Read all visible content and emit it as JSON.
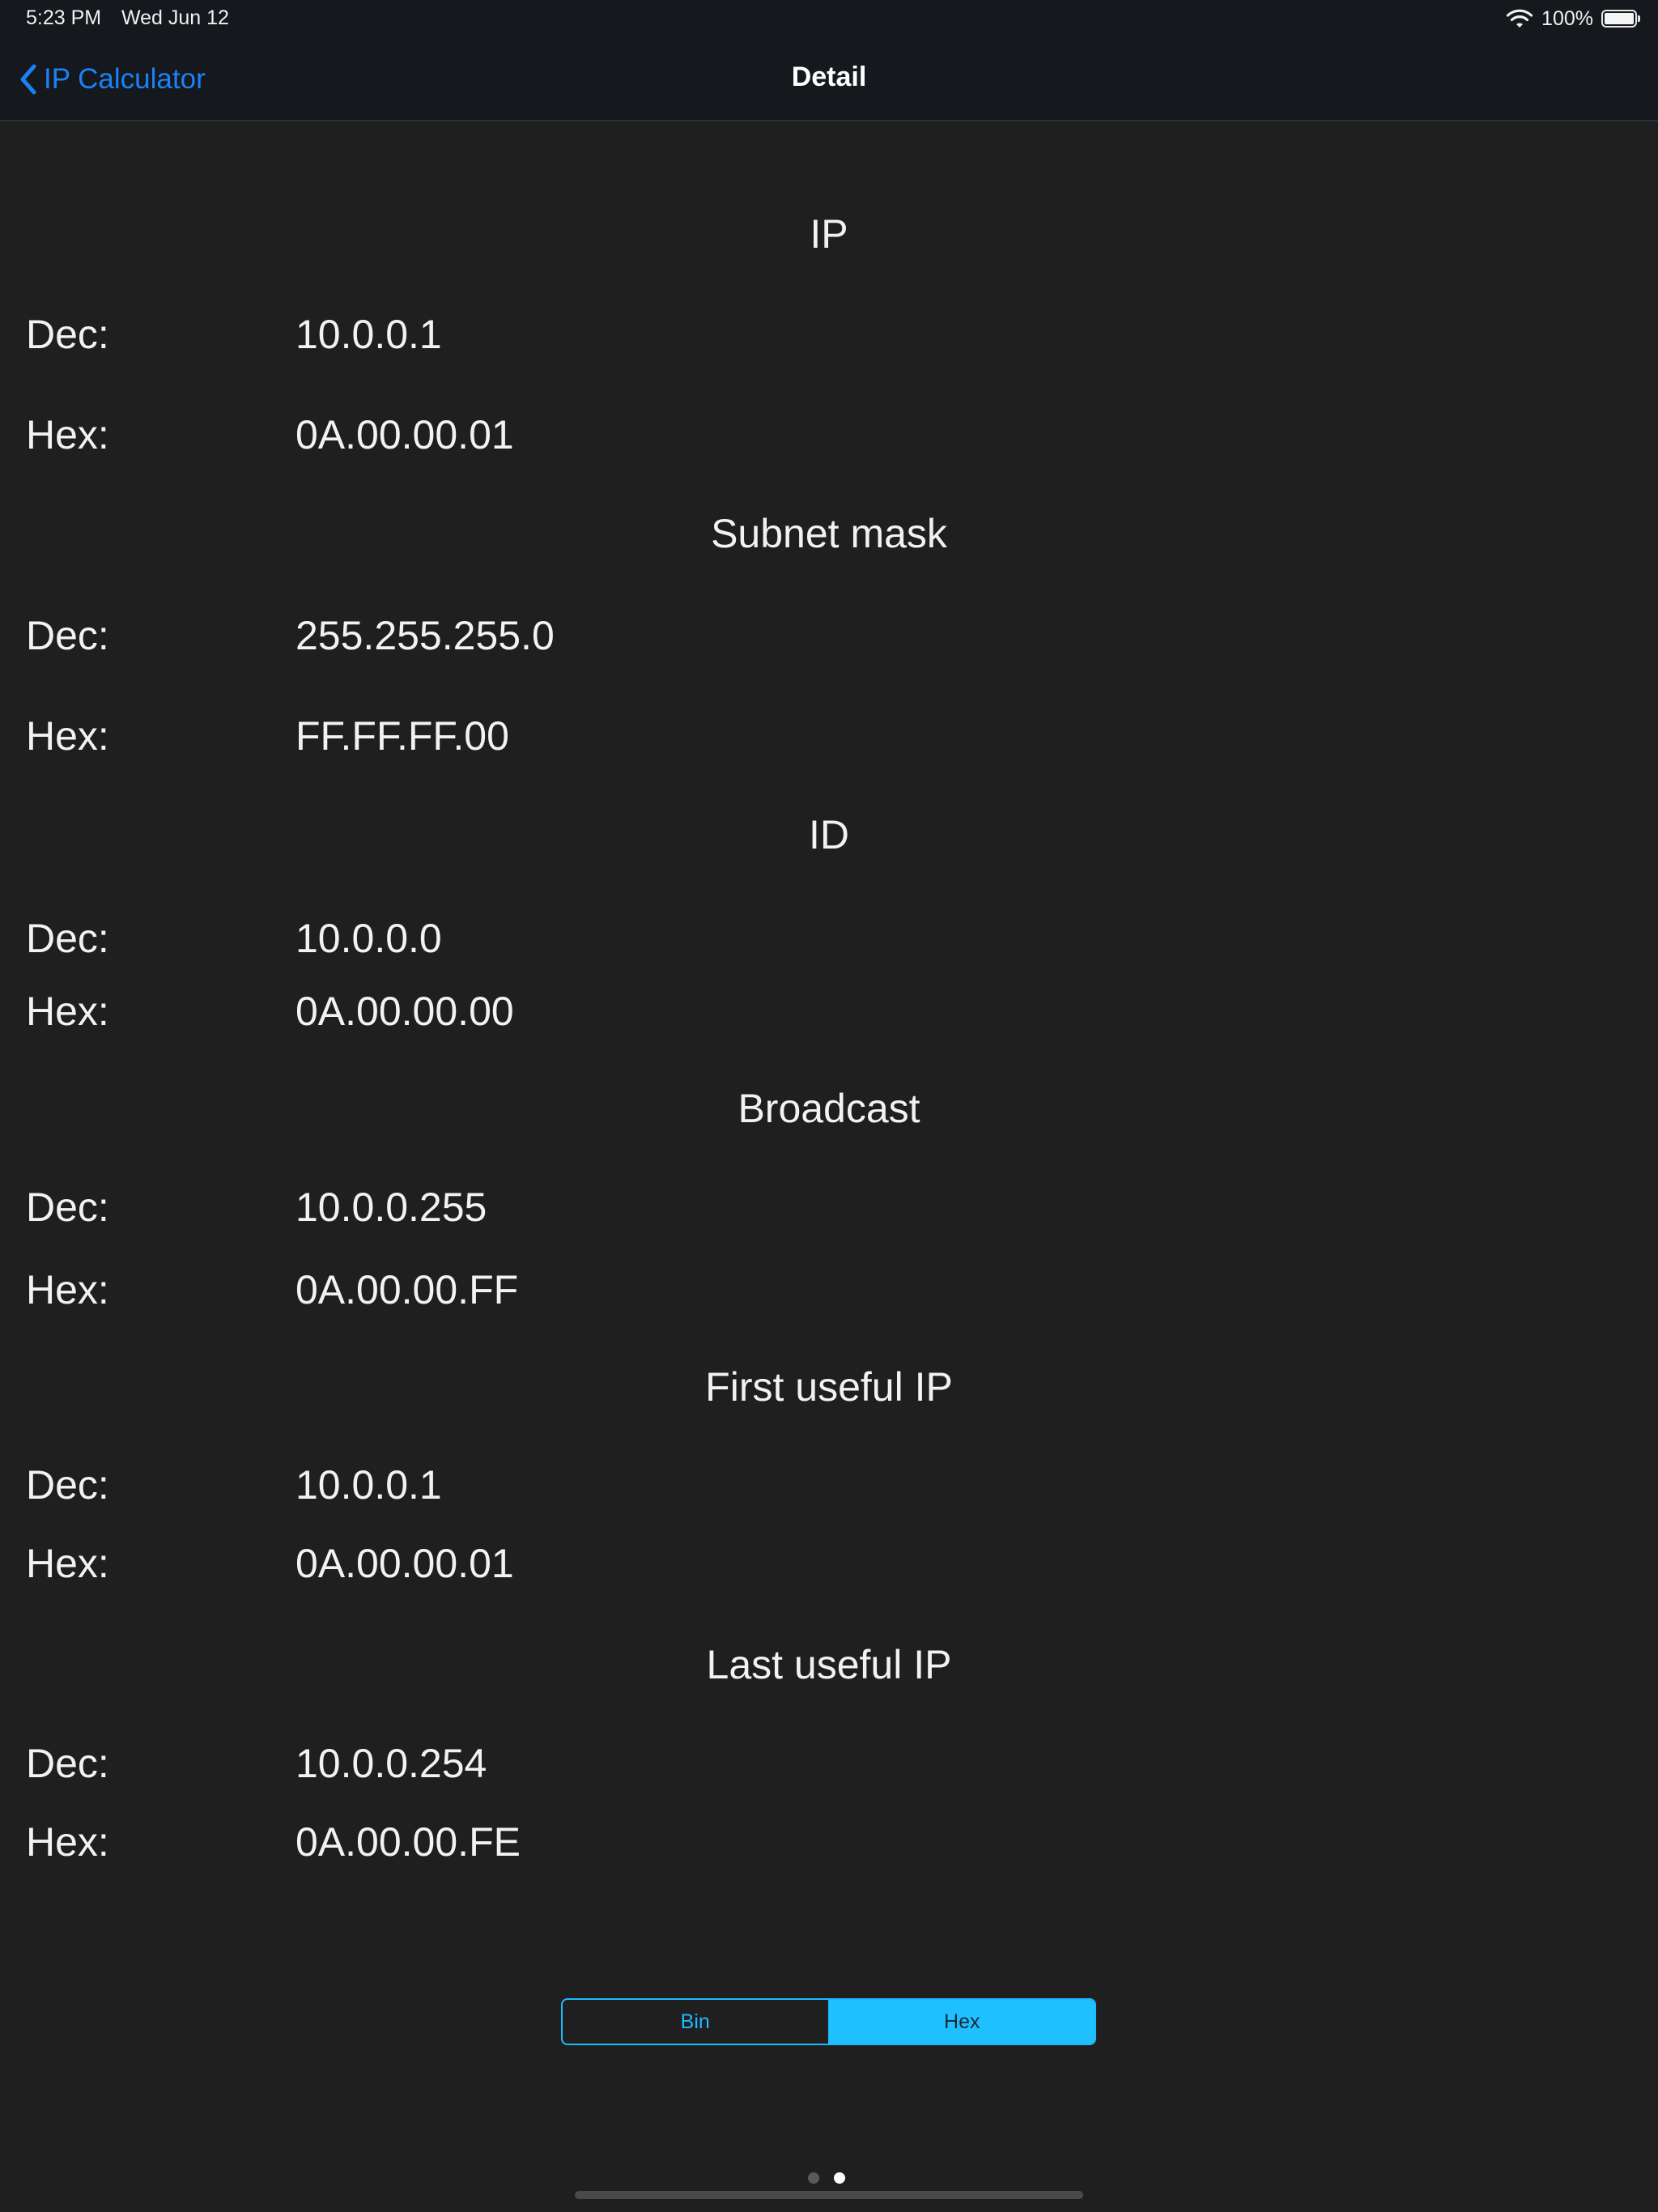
{
  "status_bar": {
    "time": "5:23 PM",
    "date": "Wed Jun 12",
    "battery": "100%"
  },
  "nav": {
    "back_label": "IP Calculator",
    "title": "Detail",
    "accent_color": "#1a82f7"
  },
  "sections": [
    {
      "title": "IP",
      "rows": [
        {
          "label": "Dec:",
          "value": "10.0.0.1"
        },
        {
          "label": "Hex:",
          "value": "0A.00.00.01"
        }
      ]
    },
    {
      "title": "Subnet mask",
      "rows": [
        {
          "label": "Dec:",
          "value": "255.255.255.0"
        },
        {
          "label": "Hex:",
          "value": "FF.FF.FF.00"
        }
      ]
    },
    {
      "title": "ID",
      "rows": [
        {
          "label": "Dec:",
          "value": "10.0.0.0"
        },
        {
          "label": "Hex:",
          "value": "0A.00.00.00"
        }
      ]
    },
    {
      "title": "Broadcast",
      "rows": [
        {
          "label": "Dec:",
          "value": "10.0.0.255"
        },
        {
          "label": "Hex:",
          "value": "0A.00.00.FF"
        }
      ]
    },
    {
      "title": "First useful IP",
      "rows": [
        {
          "label": "Dec:",
          "value": "10.0.0.1"
        },
        {
          "label": "Hex:",
          "value": "0A.00.00.01"
        }
      ]
    },
    {
      "title": "Last useful IP",
      "rows": [
        {
          "label": "Dec:",
          "value": "10.0.0.254"
        },
        {
          "label": "Hex:",
          "value": "0A.00.00.FE"
        }
      ]
    }
  ],
  "segmented_control": {
    "options": [
      "Bin",
      "Hex"
    ],
    "selected": "Hex",
    "accent_color": "#1fc0ff"
  },
  "page_indicator": {
    "pages": 2,
    "current": 2
  }
}
